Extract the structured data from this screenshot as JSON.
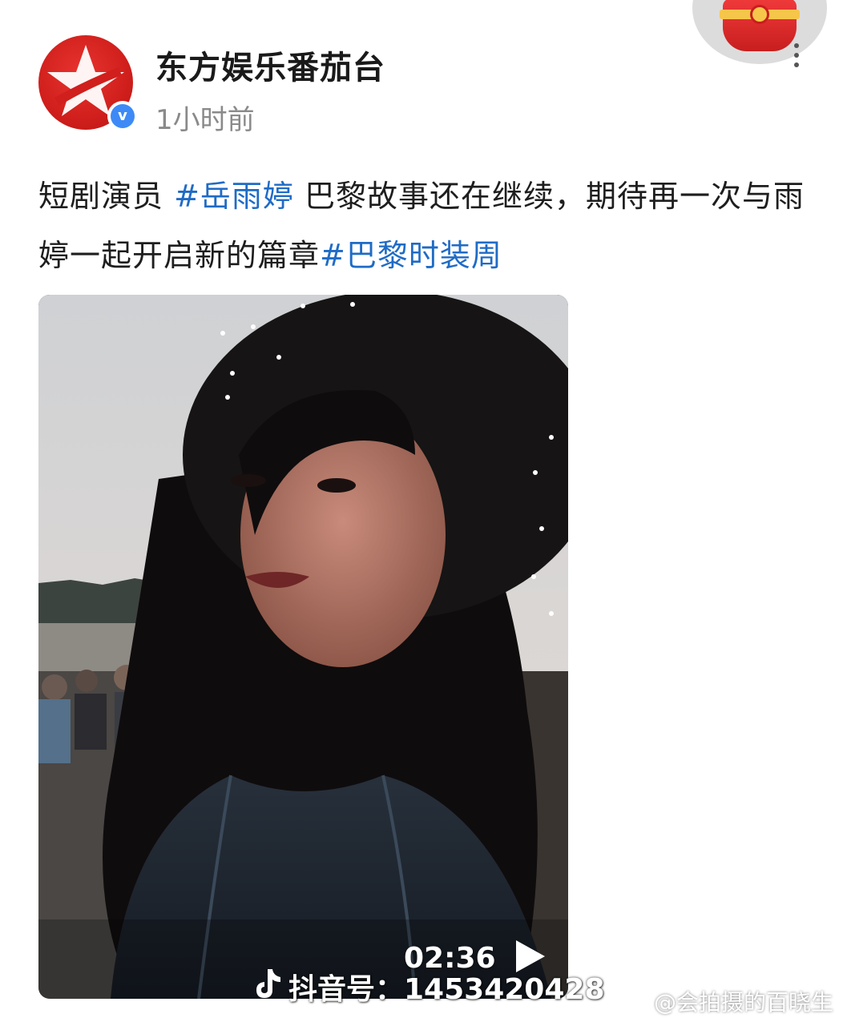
{
  "post": {
    "author": "东方娱乐番茄台",
    "verified_mark": "v",
    "time": "1小时前",
    "text_prefix": "短剧演员 ",
    "hashtag_1": "#岳雨婷",
    "text_middle": " 巴黎故事还在继续，期待再一次与雨婷一起开启新的篇章",
    "hashtag_2": "#巴黎时装周"
  },
  "video": {
    "duration": "02:36",
    "douyin_id": "抖音号：1453420428",
    "watermark": "@会拍摄的百晓生"
  },
  "colors": {
    "hashtag": "#1f6bc6",
    "avatar_red": "#d01f1c",
    "verified_blue": "#3d8af7"
  },
  "icons": {
    "avatar": "dragon-tv-star-logo",
    "verified": "verified-badge-icon",
    "play": "play-icon",
    "douyin": "douyin-logo-icon",
    "weibo": "weibo-icon",
    "more": "more-vertical-icon"
  }
}
